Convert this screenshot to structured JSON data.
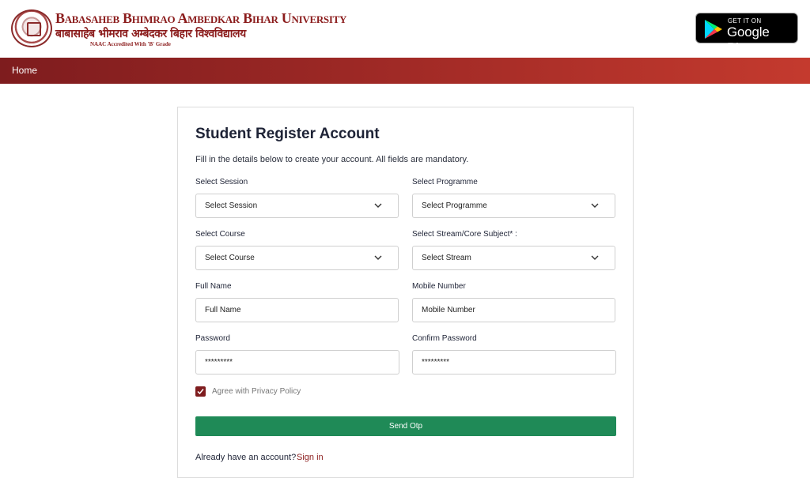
{
  "header": {
    "logo_line1": "Babasaheb Bhimrao Ambedkar Bihar University",
    "logo_line2": "बाबासाहेब भीमराव अम्बेदकर बिहार विश्वविद्यालय",
    "logo_line3": "NAAC Accredited With 'B' Grade",
    "store_small": "GET IT ON",
    "store_big": "Google Play"
  },
  "nav": {
    "home": "Home"
  },
  "form": {
    "title": "Student Register Account",
    "subtitle": "Fill in the details below to create your account. All fields are mandatory.",
    "session": {
      "label": "Select Session",
      "value": "Select Session"
    },
    "programme": {
      "label": "Select Programme",
      "value": "Select Programme"
    },
    "course": {
      "label": "Select Course",
      "value": "Select Course"
    },
    "stream": {
      "label": "Select Stream/Core Subject* :",
      "value": "Select Stream"
    },
    "full_name": {
      "label": "Full Name",
      "placeholder": "Full Name"
    },
    "mobile": {
      "label": "Mobile Number",
      "placeholder": "Mobile Number"
    },
    "password": {
      "label": "Password",
      "value": "*********"
    },
    "confirm_password": {
      "label": "Confirm Password",
      "value": "*********"
    },
    "privacy": {
      "label": "Agree with Privacy Policy",
      "checked": true
    },
    "submit": "Send Otp",
    "already": "Already have an account?",
    "signin": "Sign in"
  },
  "colors": {
    "brand": "#7e1c1e",
    "button": "#1f8a57",
    "link": "#8b1c1c"
  }
}
